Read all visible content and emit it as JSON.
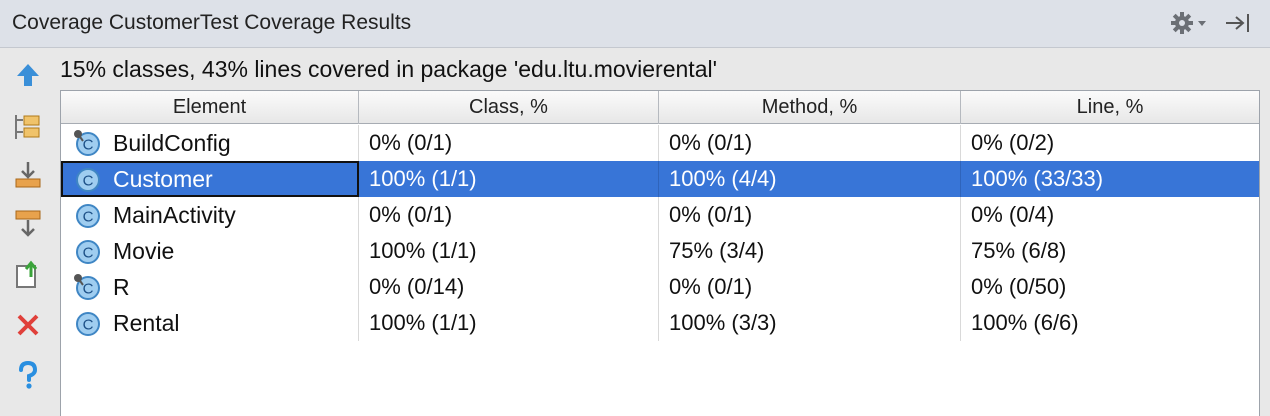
{
  "window": {
    "title": "Coverage CustomerTest Coverage Results"
  },
  "toolbar_icons": [
    "up-arrow-icon",
    "flatten-packages-icon",
    "import-icon",
    "scroll-to-source-icon",
    "export-icon",
    "close-icon",
    "help-icon"
  ],
  "summary": "15% classes, 43% lines covered in package 'edu.ltu.movierental'",
  "columns": [
    "Element",
    "Class, %",
    "Method, %",
    "Line, %"
  ],
  "rows": [
    {
      "name": "BuildConfig",
      "class": "0% (0/1)",
      "method": "0% (0/1)",
      "line": "0% (0/2)",
      "generated": true,
      "selected": false
    },
    {
      "name": "Customer",
      "class": "100% (1/1)",
      "method": "100% (4/4)",
      "line": "100% (33/33)",
      "generated": false,
      "selected": true
    },
    {
      "name": "MainActivity",
      "class": "0% (0/1)",
      "method": "0% (0/1)",
      "line": "0% (0/4)",
      "generated": false,
      "selected": false
    },
    {
      "name": "Movie",
      "class": "100% (1/1)",
      "method": "75% (3/4)",
      "line": "75% (6/8)",
      "generated": false,
      "selected": false
    },
    {
      "name": "R",
      "class": "0% (0/14)",
      "method": "0% (0/1)",
      "line": "0% (0/50)",
      "generated": true,
      "selected": false
    },
    {
      "name": "Rental",
      "class": "100% (1/1)",
      "method": "100% (3/3)",
      "line": "100% (6/6)",
      "generated": false,
      "selected": false
    }
  ],
  "colors": {
    "selection": "#3875d7",
    "header_bg": "#dde1e8",
    "class_icon": "#7ab8e6"
  }
}
